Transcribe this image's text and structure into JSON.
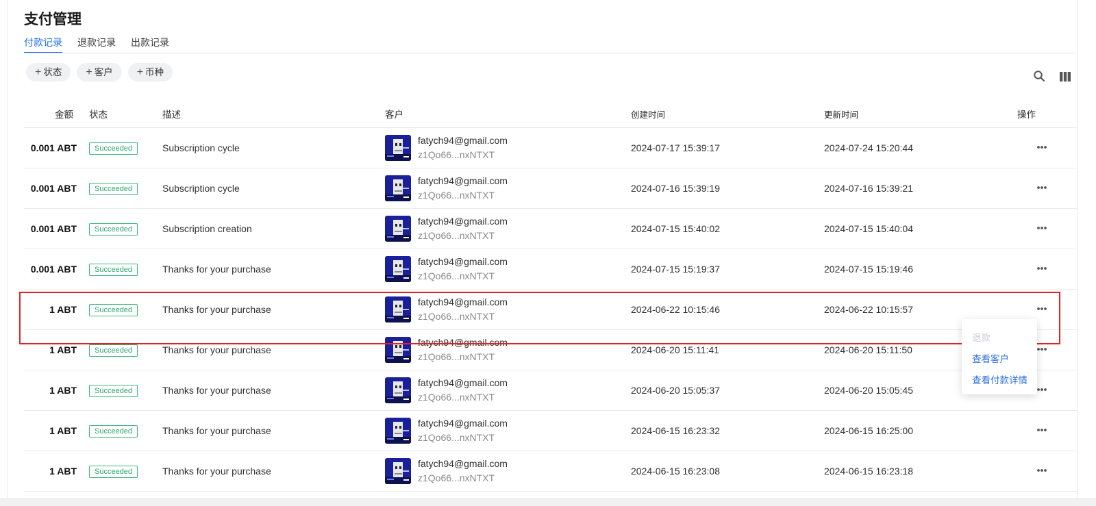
{
  "page": {
    "title": "支付管理"
  },
  "tabs": [
    {
      "label": "付款记录",
      "active": true
    },
    {
      "label": "退款记录",
      "active": false
    },
    {
      "label": "出款记录",
      "active": false
    }
  ],
  "filters": [
    {
      "plus": "+",
      "label": "状态"
    },
    {
      "plus": "+",
      "label": "客户"
    },
    {
      "plus": "+",
      "label": "币种"
    }
  ],
  "toolbar": {
    "search_icon": "search-icon",
    "columns_icon": "columns-icon"
  },
  "table": {
    "headers": {
      "amount": "金额",
      "status": "状态",
      "description": "描述",
      "customer": "客户",
      "created": "创建时间",
      "updated": "更新时间",
      "actions": "操作"
    },
    "rows": [
      {
        "amount": "0.001 ABT",
        "status": "Succeeded",
        "description": "Subscription cycle",
        "email": "fatych94@gmail.com",
        "did": "z1Qo66...nxNTXT",
        "created": "2024-07-17 15:39:17",
        "updated": "2024-07-24 15:20:44"
      },
      {
        "amount": "0.001 ABT",
        "status": "Succeeded",
        "description": "Subscription cycle",
        "email": "fatych94@gmail.com",
        "did": "z1Qo66...nxNTXT",
        "created": "2024-07-16 15:39:19",
        "updated": "2024-07-16 15:39:21"
      },
      {
        "amount": "0.001 ABT",
        "status": "Succeeded",
        "description": "Subscription creation",
        "email": "fatych94@gmail.com",
        "did": "z1Qo66...nxNTXT",
        "created": "2024-07-15 15:40:02",
        "updated": "2024-07-15 15:40:04"
      },
      {
        "amount": "0.001 ABT",
        "status": "Succeeded",
        "description": "Thanks for your purchase",
        "email": "fatych94@gmail.com",
        "did": "z1Qo66...nxNTXT",
        "created": "2024-07-15 15:19:37",
        "updated": "2024-07-15 15:19:46"
      },
      {
        "amount": "1 ABT",
        "status": "Succeeded",
        "description": "Thanks for your purchase",
        "email": "fatych94@gmail.com",
        "did": "z1Qo66...nxNTXT",
        "created": "2024-06-22 10:15:46",
        "updated": "2024-06-22 10:15:57"
      },
      {
        "amount": "1 ABT",
        "status": "Succeeded",
        "description": "Thanks for your purchase",
        "email": "fatych94@gmail.com",
        "did": "z1Qo66...nxNTXT",
        "created": "2024-06-20 15:11:41",
        "updated": "2024-06-20 15:11:50"
      },
      {
        "amount": "1 ABT",
        "status": "Succeeded",
        "description": "Thanks for your purchase",
        "email": "fatych94@gmail.com",
        "did": "z1Qo66...nxNTXT",
        "created": "2024-06-20 15:05:37",
        "updated": "2024-06-20 15:05:45"
      },
      {
        "amount": "1 ABT",
        "status": "Succeeded",
        "description": "Thanks for your purchase",
        "email": "fatych94@gmail.com",
        "did": "z1Qo66...nxNTXT",
        "created": "2024-06-15 16:23:32",
        "updated": "2024-06-15 16:25:00"
      },
      {
        "amount": "1 ABT",
        "status": "Succeeded",
        "description": "Thanks for your purchase",
        "email": "fatych94@gmail.com",
        "did": "z1Qo66...nxNTXT",
        "created": "2024-06-15 16:23:08",
        "updated": "2024-06-15 16:23:18"
      }
    ]
  },
  "action_menu": {
    "items": [
      {
        "label": "退款",
        "disabled": true
      },
      {
        "label": "查看客户",
        "disabled": false
      },
      {
        "label": "查看付款详情",
        "disabled": false
      }
    ]
  },
  "colors": {
    "accent": "#1f6fea",
    "success": "#2ea66f",
    "highlight": "#e02424"
  }
}
